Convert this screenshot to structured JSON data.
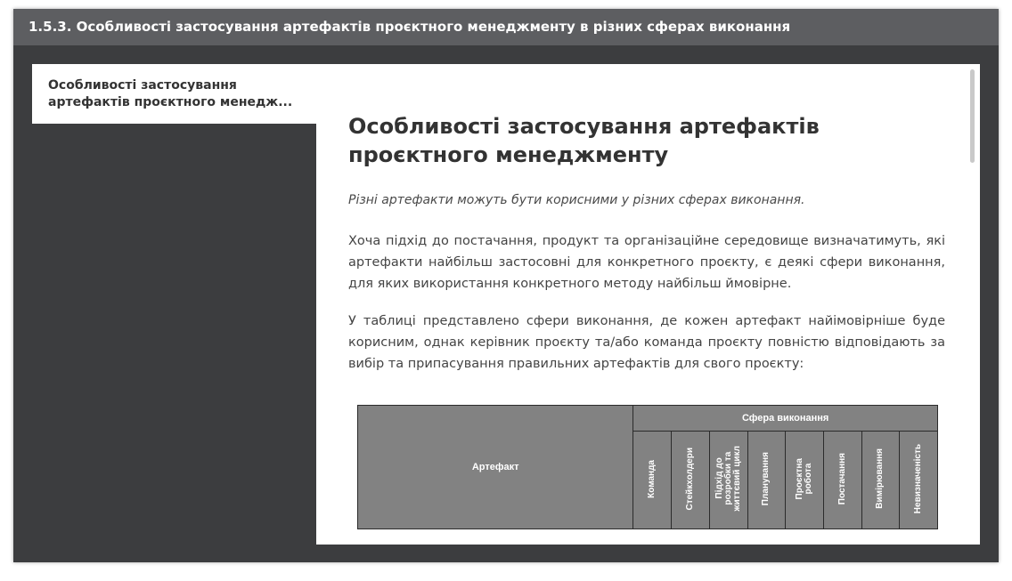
{
  "window": {
    "title": "1.5.3. Особливості застосування артефактів проєктного менеджменту в різних сферах виконання"
  },
  "tab": {
    "line1": "Особливості застосування",
    "line2": "артефактів проєктного менедж..."
  },
  "article": {
    "heading_line1": "Особливості застосування артефактів",
    "heading_line2": "проєктного менеджменту",
    "intro": "Різні артефакти можуть бути корисними у різних сферах виконання.",
    "paragraph1": "Хоча підхід до постачання, продукт та організаційне середовище визначатимуть, які артефакти найбільш застосовні для конкретного проєкту, є деякі сфери виконання, для яких використання конкретного методу найбільш ймовірне.",
    "paragraph2": "У таблиці представлено сфери виконання, де кожен артефакт найімовірніше буде корисним, однак керівник проєкту та/або команда проєкту повністю відповідають за вибір та припасування правильних артефактів для свого проєкту:"
  },
  "table": {
    "artifact_header": "Артефакт",
    "domain_header": "Сфера виконання",
    "columns": [
      "Команда",
      "Стейкхолдери",
      "Підхід до\nрозробки та\nжиттєвий цикл",
      "Планування",
      "Проєктна\nробота",
      "Постачання",
      "Вимірювання",
      "Невизначеність"
    ]
  },
  "colors": {
    "titlebar": "#5d5e61",
    "background": "#3c3d3f",
    "table_header": "#828282"
  }
}
